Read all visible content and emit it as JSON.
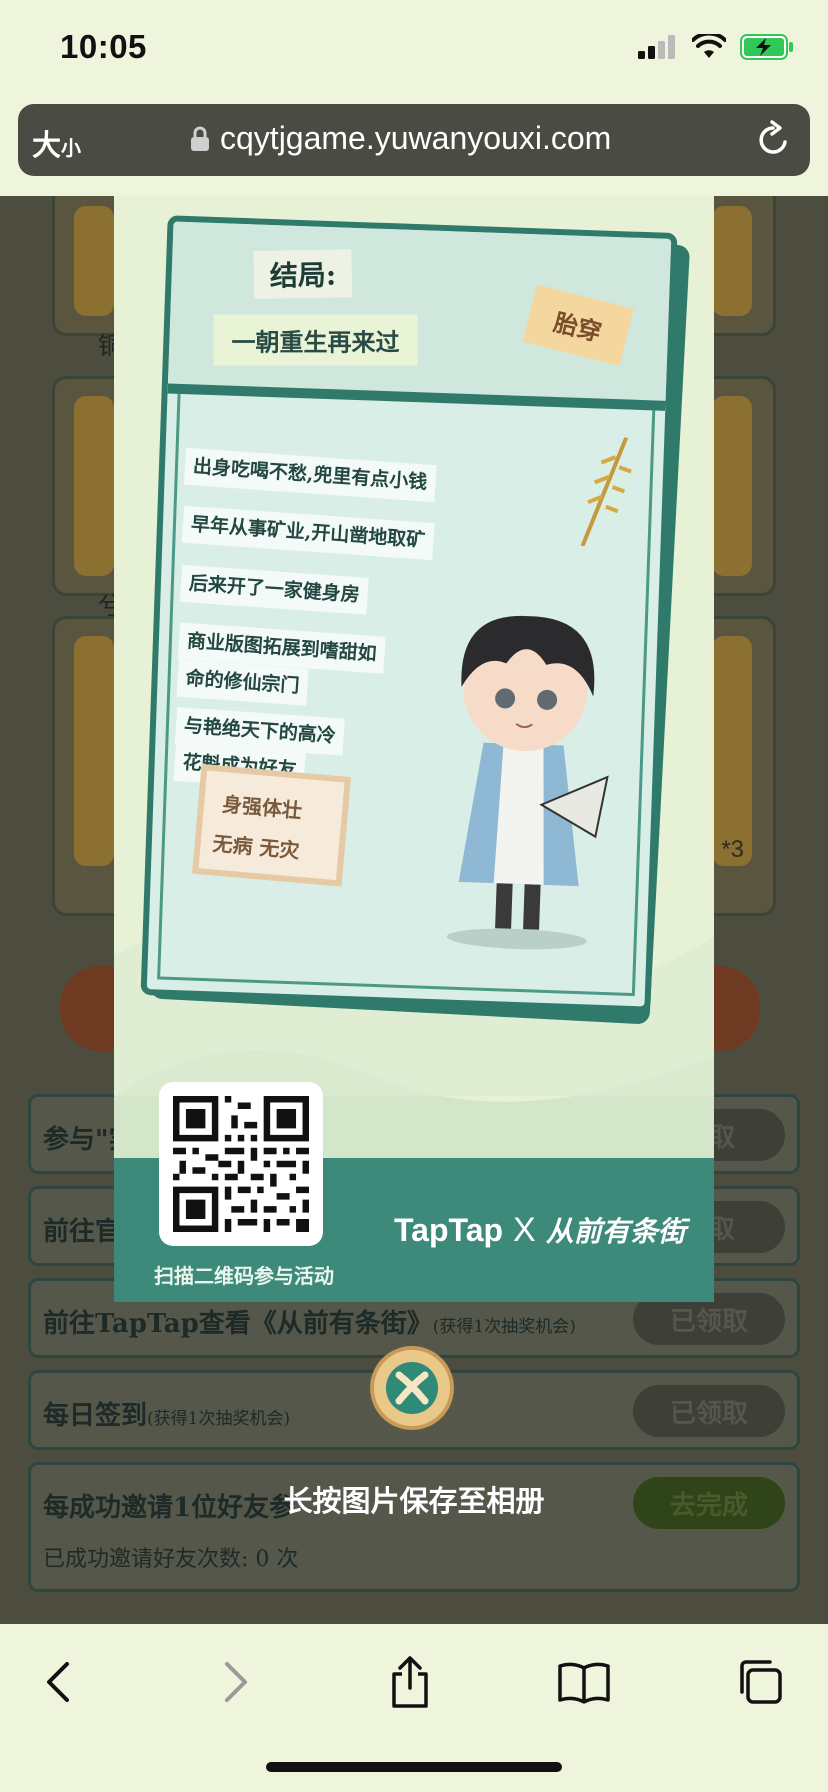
{
  "status_bar": {
    "time": "10:05"
  },
  "url_bar": {
    "text_size_label": "大",
    "text_size_small": "小",
    "domain": "cqytjgame.yuwanyouxi.com"
  },
  "background_page": {
    "glyphs": [
      "铜",
      "兮"
    ],
    "multiplier": "*3",
    "tasks": [
      {
        "label": "参与\"实",
        "button": "领取"
      },
      {
        "label": "前往官",
        "button": "领取"
      },
      {
        "label": "前往TapTap查看《从前有条街》",
        "note": "(获得1次抽奖机会)",
        "button": "已领取"
      },
      {
        "label": "每日签到",
        "note": "(获得1次抽奖机会)",
        "button": "已领取"
      },
      {
        "label": "每成功邀请1位好友参",
        "button": "去完成",
        "sub": "已成功邀请好友次数: 0 次"
      }
    ]
  },
  "poster": {
    "ending_label": "结局:",
    "ending_title": "一朝重生再来过",
    "tag": "胎穿",
    "story_lines": [
      "出身吃喝不愁,兜里有点小钱",
      "早年从事矿业,开山凿地取矿",
      "后来开了一家健身房",
      "商业版图拓展到嗜甜如",
      "命的修仙宗门",
      "与艳绝天下的高冷",
      "花魁成为好友"
    ],
    "health_line1": "身强体壮",
    "health_line2": "无病 无灾",
    "qr_caption": "扫描二维码参与活动",
    "brand_taptap": "TapTap",
    "brand_x": "X",
    "brand_game": "从前有条街"
  },
  "save_hint": "长按图片保存至相册",
  "colors": {
    "teal": "#2f7a6a",
    "poster_bg": "#e6f1d6",
    "overlay": "#4d4d3f"
  }
}
